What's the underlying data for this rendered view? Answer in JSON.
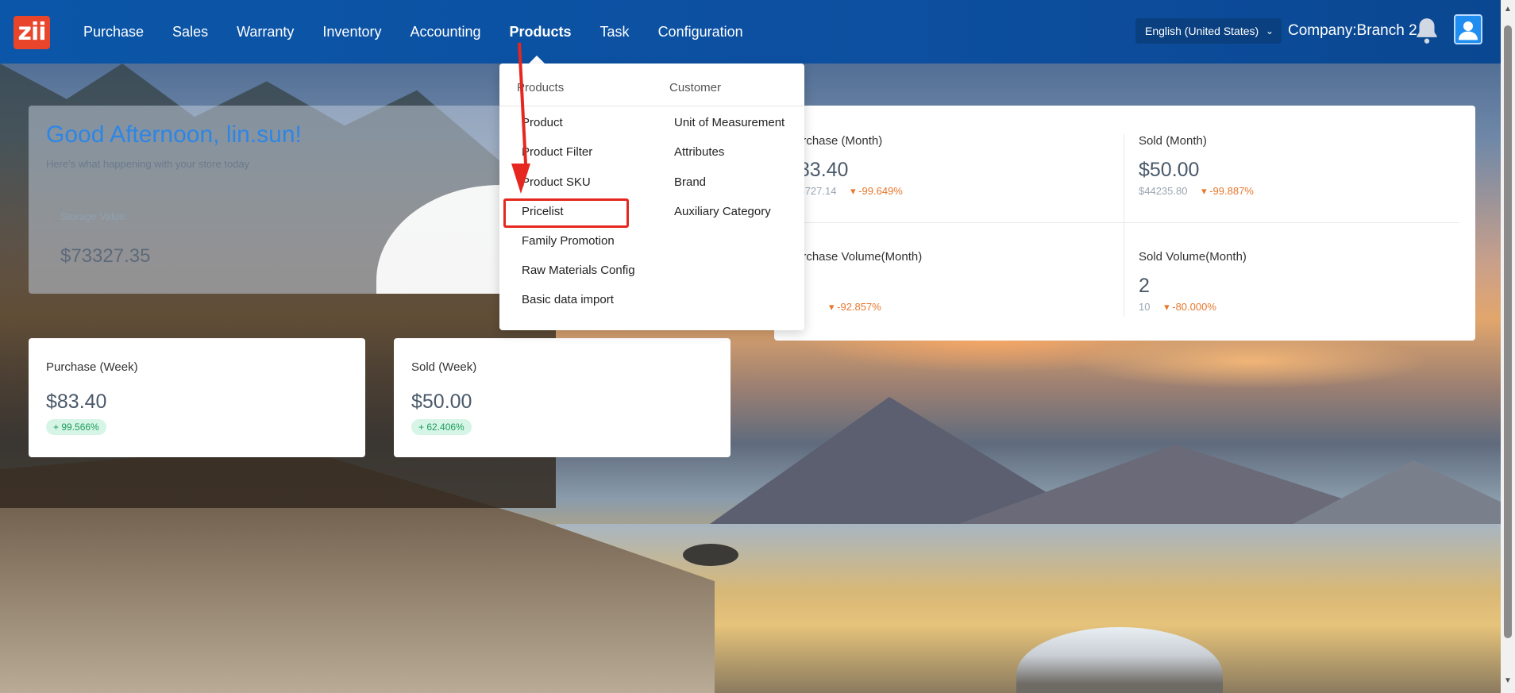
{
  "nav": {
    "logo_text": "zii",
    "items": [
      {
        "label": "Purchase",
        "active": false
      },
      {
        "label": "Sales",
        "active": false
      },
      {
        "label": "Warranty",
        "active": false
      },
      {
        "label": "Inventory",
        "active": false
      },
      {
        "label": "Accounting",
        "active": false
      },
      {
        "label": "Products",
        "active": true
      },
      {
        "label": "Task",
        "active": false
      },
      {
        "label": "Configuration",
        "active": false
      }
    ],
    "language": "English (United States)",
    "company": "Company:Branch 2"
  },
  "dropdown": {
    "col1_header": "Products",
    "col2_header": "Customer",
    "col1_items": [
      "Product",
      "Product Filter",
      "Product SKU",
      "Pricelist",
      "Family Promotion",
      "Raw Materials Config",
      "Basic data import"
    ],
    "col2_items": [
      "Unit of Measurement",
      "Attributes",
      "Brand",
      "Auxiliary Category"
    ],
    "highlighted": "Pricelist"
  },
  "greeting": {
    "title": "Good Afternoon, lin.sun!",
    "subtitle": "Here's what happening with your store today",
    "storage_label": "Storage Value",
    "storage_value": "$73327.35"
  },
  "month_stats": {
    "purchase_month": {
      "label": "Purchase (Month)",
      "value": "$83.40",
      "prev": "$23727.14",
      "pct": "-99.649%"
    },
    "sold_month": {
      "label": "Sold (Month)",
      "value": "$50.00",
      "prev": "$44235.80",
      "pct": "-99.887%"
    },
    "purchase_volume": {
      "label": "Purchase Volume(Month)",
      "value": "",
      "prev": "",
      "pct": "-92.857%"
    },
    "sold_volume": {
      "label": "Sold Volume(Month)",
      "value": "2",
      "prev": "10",
      "pct": "-80.000%"
    }
  },
  "week_stats": {
    "purchase_week": {
      "label": "Purchase (Week)",
      "value": "$83.40",
      "badge": "+ 99.566%"
    },
    "sold_week": {
      "label": "Sold (Week)",
      "value": "$50.00",
      "badge": "+ 62.406%"
    }
  },
  "colors": {
    "nav_bg": "#0b56a8",
    "accent_red": "#e5271f",
    "positive": "#1a9c5c",
    "negative": "#e8782d"
  }
}
